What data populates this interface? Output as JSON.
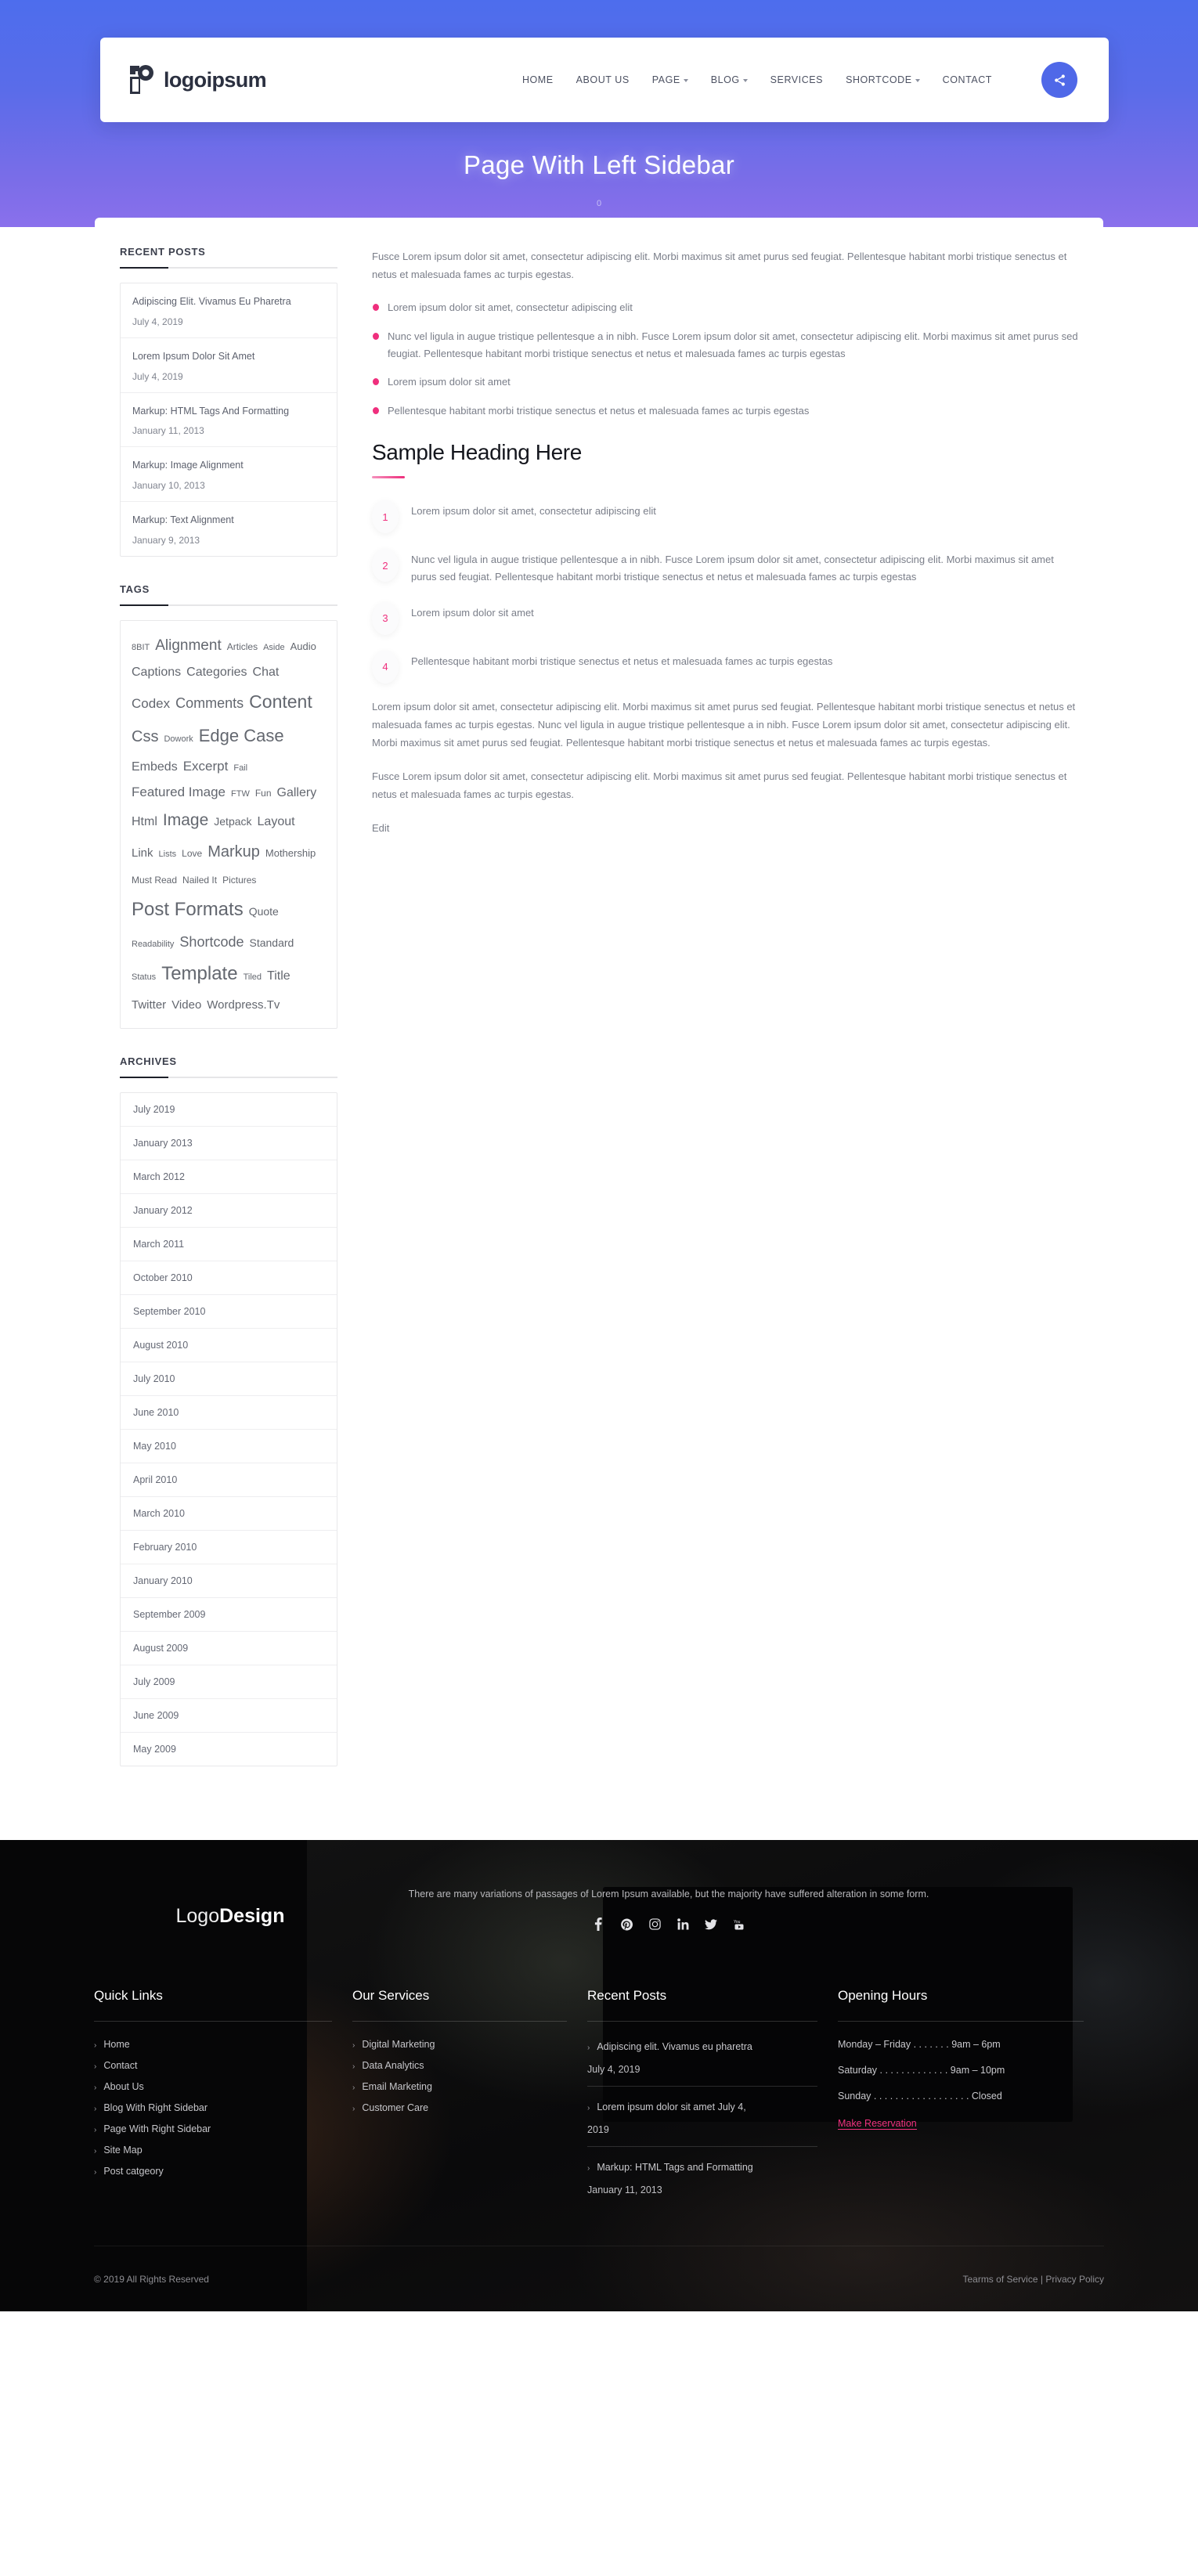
{
  "header": {
    "logo_text": "logoipsum",
    "logo_icon": "logoipsum-mark-icon",
    "nav": [
      {
        "label": "HOME",
        "has_caret": false
      },
      {
        "label": "ABOUT US",
        "has_caret": false
      },
      {
        "label": "PAGE",
        "has_caret": true
      },
      {
        "label": "BLOG",
        "has_caret": true
      },
      {
        "label": "SERVICES",
        "has_caret": false
      },
      {
        "label": "SHORTCODE",
        "has_caret": true
      },
      {
        "label": "CONTACT",
        "has_caret": false
      }
    ],
    "share_icon": "share-icon",
    "accent_color": "#4f68e8"
  },
  "hero": {
    "title": "Page With Left Sidebar",
    "subtitle": "0",
    "gradient_from": "#4d6ded",
    "gradient_to": "#8a70ec"
  },
  "sidebar": {
    "recent_posts": {
      "title": "RECENT POSTS",
      "items": [
        {
          "title": "Adipiscing Elit. Vivamus Eu Pharetra",
          "date": "July 4, 2019"
        },
        {
          "title": "Lorem Ipsum Dolor Sit Amet",
          "date": "July 4, 2019"
        },
        {
          "title": "Markup: HTML Tags And Formatting",
          "date": "January 11, 2013"
        },
        {
          "title": "Markup: Image Alignment",
          "date": "January 10, 2013"
        },
        {
          "title": "Markup: Text Alignment",
          "date": "January 9, 2013"
        }
      ]
    },
    "tags": {
      "title": "TAGS",
      "items": [
        {
          "label": "8BIT",
          "size": 11
        },
        {
          "label": "Alignment",
          "size": 19
        },
        {
          "label": "Articles",
          "size": 12
        },
        {
          "label": "Aside",
          "size": 11
        },
        {
          "label": "Audio",
          "size": 13
        },
        {
          "label": "Captions",
          "size": 16
        },
        {
          "label": "Categories",
          "size": 16
        },
        {
          "label": "Chat",
          "size": 16
        },
        {
          "label": "Codex",
          "size": 17
        },
        {
          "label": "Comments",
          "size": 18
        },
        {
          "label": "Content",
          "size": 23
        },
        {
          "label": "Css",
          "size": 20
        },
        {
          "label": "Dowork",
          "size": 11
        },
        {
          "label": "Edge Case",
          "size": 22
        },
        {
          "label": "Embeds",
          "size": 16
        },
        {
          "label": "Excerpt",
          "size": 17
        },
        {
          "label": "Fail",
          "size": 11
        },
        {
          "label": "Featured Image",
          "size": 17
        },
        {
          "label": "FTW",
          "size": 11
        },
        {
          "label": "Fun",
          "size": 12
        },
        {
          "label": "Gallery",
          "size": 16
        },
        {
          "label": "Html",
          "size": 16
        },
        {
          "label": "Image",
          "size": 21
        },
        {
          "label": "Jetpack",
          "size": 14
        },
        {
          "label": "Layout",
          "size": 16
        },
        {
          "label": "Link",
          "size": 15
        },
        {
          "label": "Lists",
          "size": 11
        },
        {
          "label": "Love",
          "size": 12
        },
        {
          "label": "Markup",
          "size": 20
        },
        {
          "label": "Mothership",
          "size": 13
        },
        {
          "label": "Must Read",
          "size": 12
        },
        {
          "label": "Nailed It",
          "size": 12
        },
        {
          "label": "Pictures",
          "size": 12
        },
        {
          "label": "Post Formats",
          "size": 24
        },
        {
          "label": "Quote",
          "size": 14
        },
        {
          "label": "Readability",
          "size": 11
        },
        {
          "label": "Shortcode",
          "size": 18
        },
        {
          "label": "Standard",
          "size": 14
        },
        {
          "label": "Status",
          "size": 11
        },
        {
          "label": "Template",
          "size": 24
        },
        {
          "label": "Tiled",
          "size": 11
        },
        {
          "label": "Title",
          "size": 16
        },
        {
          "label": "Twitter",
          "size": 15
        },
        {
          "label": "Video",
          "size": 15
        },
        {
          "label": "Wordpress.Tv",
          "size": 15
        }
      ]
    },
    "archives": {
      "title": "ARCHIVES",
      "items": [
        "July 2019",
        "January 2013",
        "March 2012",
        "January 2012",
        "March 2011",
        "October 2010",
        "September 2010",
        "August 2010",
        "July 2010",
        "June 2010",
        "May 2010",
        "April 2010",
        "March 2010",
        "February 2010",
        "January 2010",
        "September 2009",
        "August 2009",
        "July 2009",
        "June 2009",
        "May 2009"
      ]
    }
  },
  "main": {
    "intro": "Fusce Lorem ipsum dolor sit amet, consectetur adipiscing elit. Morbi maximus sit amet purus sed feugiat. Pellentesque habitant morbi tristique senectus et netus et malesuada fames ac turpis egestas.",
    "bullets": [
      "Lorem ipsum dolor sit amet, consectetur adipiscing elit",
      "Nunc vel ligula in augue tristique pellentesque a in nibh. Fusce Lorem ipsum dolor sit amet, consectetur adipiscing elit. Morbi maximus sit amet purus sed feugiat. Pellentesque habitant morbi tristique senectus et netus et malesuada fames ac turpis egestas",
      "Lorem ipsum dolor sit amet",
      "Pellentesque habitant morbi tristique senectus et netus et malesuada fames ac turpis egestas"
    ],
    "heading": "Sample Heading Here",
    "numbered": [
      {
        "n": "1",
        "text": "Lorem ipsum dolor sit amet, consectetur adipiscing elit"
      },
      {
        "n": "2",
        "text": "Nunc vel ligula in augue tristique pellentesque a in nibh. Fusce Lorem ipsum dolor sit amet, consectetur adipiscing elit. Morbi maximus sit amet purus sed feugiat. Pellentesque habitant morbi tristique senectus et netus et malesuada fames ac turpis egestas"
      },
      {
        "n": "3",
        "text": "Lorem ipsum dolor sit amet"
      },
      {
        "n": "4",
        "text": "Pellentesque habitant morbi tristique senectus et netus et malesuada fames ac turpis egestas"
      }
    ],
    "para2": "Lorem ipsum dolor sit amet, consectetur adipiscing elit. Morbi maximus sit amet purus sed feugiat. Pellentesque habitant morbi tristique senectus et netus et malesuada fames ac turpis egestas. Nunc vel ligula in augue tristique pellentesque a in nibh. Fusce Lorem ipsum dolor sit amet, consectetur adipiscing elit. Morbi maximus sit amet purus sed feugiat. Pellentesque habitant morbi tristique senectus et netus et malesuada fames ac turpis egestas.",
    "para3": "Fusce Lorem ipsum dolor sit amet, consectetur adipiscing elit. Morbi maximus sit amet purus sed feugiat. Pellentesque habitant morbi tristique senectus et netus et malesuada fames ac turpis egestas.",
    "edit_label": "Edit",
    "bullet_color": "#ef2f7d"
  },
  "footer": {
    "logo_light": "Logo",
    "logo_bold": "Design",
    "tagline": "There are many variations of passages of Lorem Ipsum available, but the majority have suffered alteration in some form.",
    "socials": [
      "facebook-icon",
      "pinterest-icon",
      "instagram-icon",
      "linkedin-icon",
      "twitter-icon",
      "youtube-icon"
    ],
    "quick_links": {
      "title": "Quick Links",
      "items": [
        "Home",
        "Contact",
        "About Us",
        "Blog With Right Sidebar",
        "Page With Right Sidebar",
        "Site Map",
        "Post catgeory"
      ]
    },
    "our_services": {
      "title": "Our Services",
      "items": [
        "Digital Marketing",
        "Data Analytics",
        "Email Marketing",
        "Customer Care"
      ]
    },
    "recent_posts": {
      "title": "Recent Posts",
      "items": [
        {
          "title": "Adipiscing elit. Vivamus eu pharetra",
          "date": "July 4, 2019"
        },
        {
          "title": "Lorem ipsum dolor sit amet July 4,",
          "date": "2019"
        },
        {
          "title": "Markup: HTML Tags and Formatting",
          "date": "January 11, 2013"
        }
      ]
    },
    "opening_hours": {
      "title": "Opening Hours",
      "rows": [
        "Monday – Friday . . . . . . . 9am – 6pm",
        "Saturday . . . . . . . . . . . . . 9am – 10pm",
        "Sunday . . . . . . . . . . . . . . . . . . Closed"
      ],
      "reserve_label": "Make Reservation",
      "reserve_color": "#f0317f"
    },
    "bottom": {
      "copyright": "© 2019 All Rights Reserved",
      "terms": "Tearms of Service",
      "separator": "|",
      "privacy": "Privacy Policy"
    }
  }
}
